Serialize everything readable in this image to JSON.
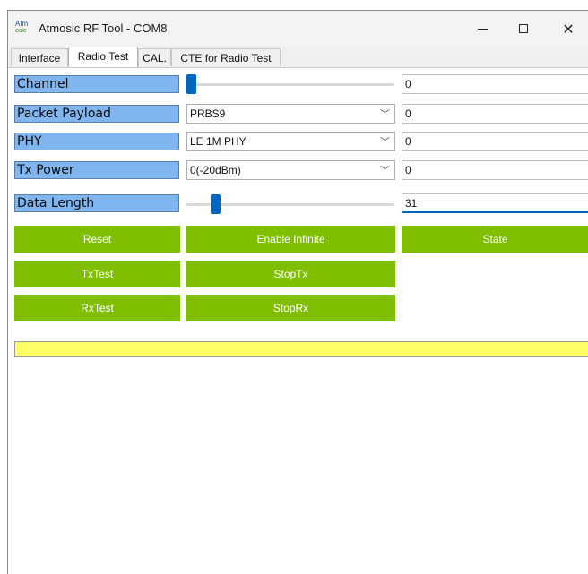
{
  "window": {
    "logo_top": "Atm",
    "logo_bottom": "osic",
    "title": "Atmosic RF Tool - COM8",
    "controls": {
      "minimize": "—",
      "maximize": "☐",
      "close": "✕"
    }
  },
  "tabs": [
    {
      "label": "Interface"
    },
    {
      "label": "Radio Test"
    },
    {
      "label": "CAL."
    },
    {
      "label": "CTE for Radio Test"
    }
  ],
  "active_tab": "Radio Test",
  "colors": {
    "label_bg": "#7fb6ef",
    "button_bg": "#7fbf00",
    "status_bg": "#ffff66",
    "slider_thumb": "#0067c0"
  },
  "rows": {
    "channel": {
      "label": "Channel",
      "value": "0",
      "slider_fraction": 0.0
    },
    "packet_payload": {
      "label": "Packet Payload",
      "selected": "PRBS9",
      "value": "0"
    },
    "phy": {
      "label": "PHY",
      "selected": "LE 1M PHY",
      "value": "0"
    },
    "tx_power": {
      "label": "Tx Power",
      "selected": "0(-20dBm)",
      "value": "0"
    },
    "data_length": {
      "label": "Data Length",
      "value": "31",
      "slider_fraction": 0.12
    }
  },
  "buttons": {
    "reset": "Reset",
    "enable_infinite": "Enable Infinite",
    "state": "State",
    "tx_test": "TxTest",
    "stop_tx": "StopTx",
    "rx_test": "RxTest",
    "stop_rx": "StopRx"
  },
  "status": {
    "text": ""
  }
}
